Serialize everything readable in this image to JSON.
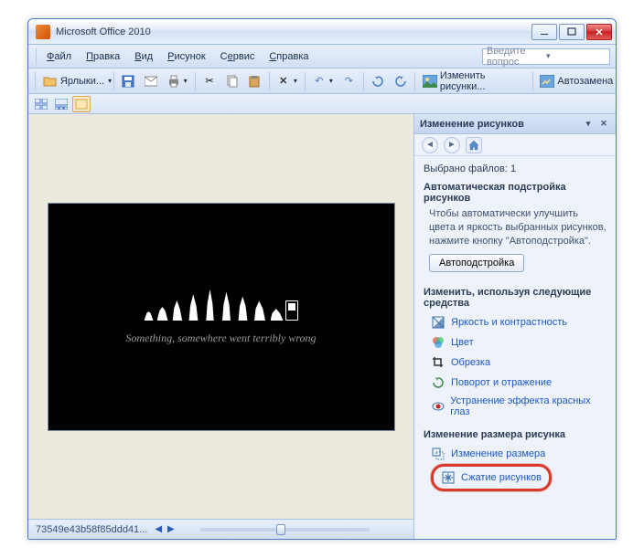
{
  "window": {
    "title": "Microsoft Office 2010"
  },
  "menu": {
    "items": [
      "Файл",
      "Правка",
      "Вид",
      "Рисунок",
      "Сервис",
      "Справка"
    ],
    "search_placeholder": "Введите вопрос"
  },
  "toolbar": {
    "shortcuts": "Ярлыки...",
    "change_pics": "Изменить рисунки...",
    "autoreplace": "Автозамена"
  },
  "status": {
    "filename": "73549e43b58f85ddd41..."
  },
  "image": {
    "caption": "Something, somewhere went terribly wrong"
  },
  "taskpane": {
    "title": "Изменение рисунков",
    "selected": "Выбрано файлов: 1",
    "auto_section": "Автоматическая подстройка рисунков",
    "auto_desc": "Чтобы автоматически улучшить цвета и яркость выбранных рисунков, нажмите кнопку \"Автоподстройка\".",
    "auto_button": "Автоподстройка",
    "edit_section": "Изменить, используя следующие средства",
    "tools": {
      "brightness": "Яркость и контрастность",
      "color": "Цвет",
      "crop": "Обрезка",
      "rotate": "Поворот и отражение",
      "redeye": "Устранение эффекта красных глаз"
    },
    "resize_section": "Изменение размера рисунка",
    "resize": "Изменение размера",
    "compress": "Сжатие рисунков"
  }
}
